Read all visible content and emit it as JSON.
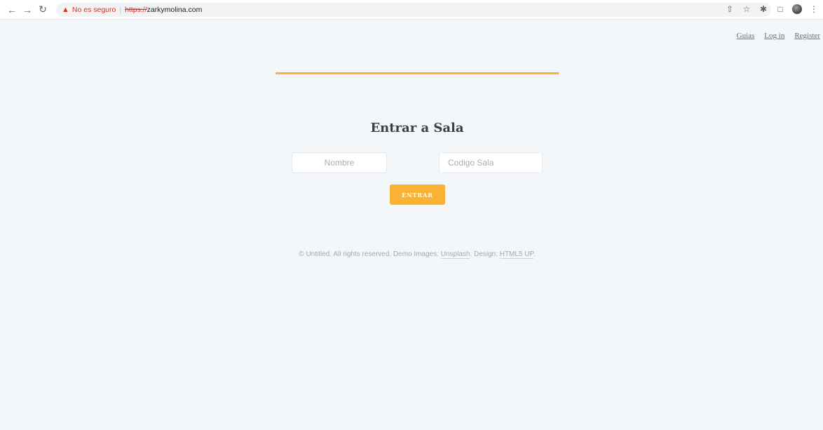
{
  "browser": {
    "insecure_label": "No es seguro",
    "url_scheme": "https://",
    "url_host": "zarkymolina.com",
    "icons": [
      "back-icon",
      "forward-icon",
      "reload-icon",
      "warning-icon",
      "share-icon",
      "star-icon",
      "extensions-icon",
      "sidebar-icon",
      "profile-avatar",
      "menu-icon"
    ]
  },
  "nav": {
    "guias": "Guias",
    "login": "Log in",
    "register": "Register"
  },
  "form": {
    "title": "Entrar a Sala",
    "name_placeholder": "Nombre",
    "room_placeholder": "Codigo Sala",
    "submit_label": "ENTRAR"
  },
  "footer": {
    "copyright": "© Untitled. All rights reserved. Demo Images: ",
    "unsplash": "Unsplash",
    "design_prefix": ". Design: ",
    "html5up": "HTML5 UP",
    "suffix": "."
  },
  "colors": {
    "accent": "#f9b233",
    "background": "#f4f7fa",
    "insecure": "#d93025"
  }
}
